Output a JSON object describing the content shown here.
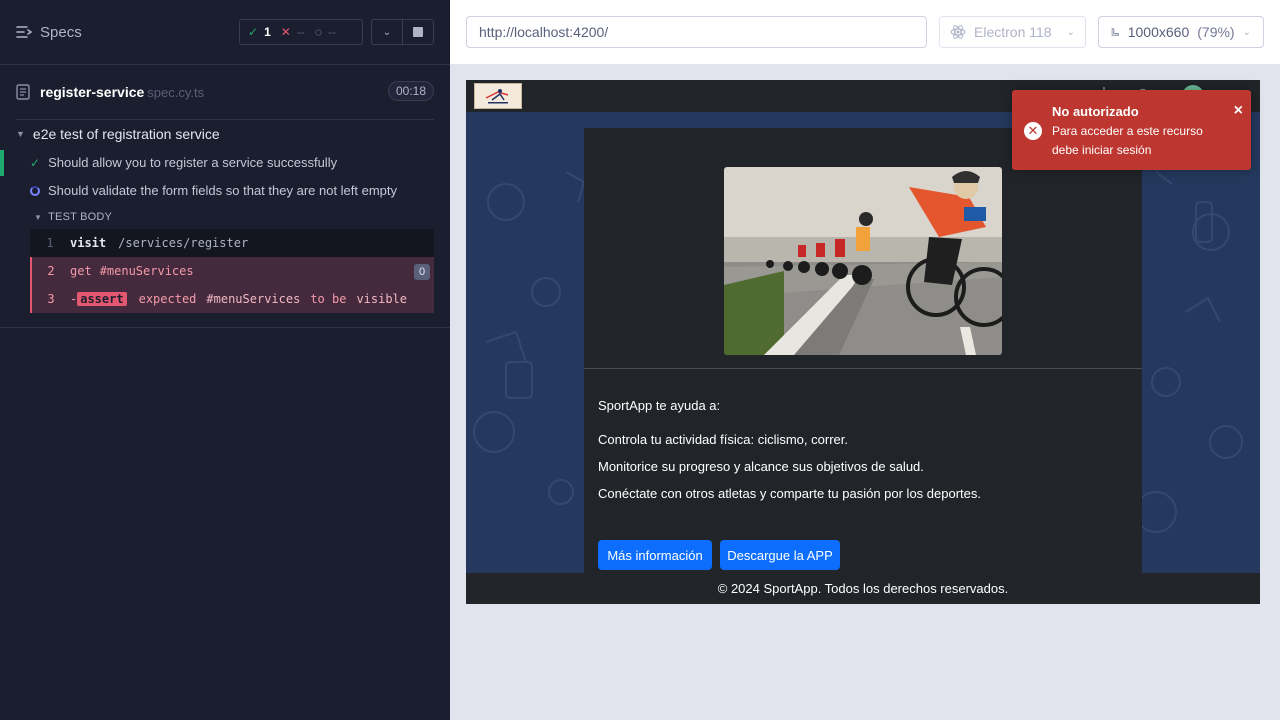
{
  "reporter": {
    "specs_label": "Specs",
    "stats": {
      "passed": "1",
      "failed": "--",
      "pending": "--"
    },
    "spec_file": {
      "name": "register-service",
      "ext": "spec.cy.ts",
      "duration": "00:18"
    },
    "suite_title": "e2e test of registration service",
    "tests": [
      {
        "title": "Should allow you to register a service successfully",
        "state": "passed"
      },
      {
        "title": "Should validate the form fields so that they are not left empty",
        "state": "running"
      }
    ],
    "test_body_label": "TEST BODY",
    "commands": [
      {
        "num": "1",
        "name": "visit",
        "message": "/services/register"
      },
      {
        "num": "2",
        "name": "get",
        "message": "#menuServices",
        "badge": "0"
      },
      {
        "num": "3",
        "name": "-",
        "tag": "assert",
        "message_parts": [
          "expected",
          "#menuServices",
          "to be",
          "visible"
        ]
      }
    ]
  },
  "topbar": {
    "url": "http://localhost:4200/",
    "browser": "Electron 118",
    "viewport": "1000x660",
    "zoom": "(79%)"
  },
  "aut": {
    "logo_alt": "SPORTAPP",
    "intro": "SportApp te ayuda a:",
    "lines": [
      "Controla tu actividad física: ciclismo, correr.",
      "Monitorice su progreso y alcance sus objetivos de salud.",
      "Conéctate con otros atletas y comparte tu pasión por los deportes."
    ],
    "btn_more": "Más información",
    "btn_download": "Descargue la APP",
    "footer": "© 2024 SportApp. Todos los derechos reservados."
  },
  "toast": {
    "title": "No autorizado",
    "message": "Para acceder a este recurso debe iniciar sesión",
    "close": "×"
  },
  "colors": {
    "reporter_bg": "#1b1e2e",
    "pass": "#1fa971",
    "fail": "#e45770",
    "aut_bg": "#25395f",
    "primary_button": "#0d6efd",
    "toast_bg": "#bd362f"
  }
}
